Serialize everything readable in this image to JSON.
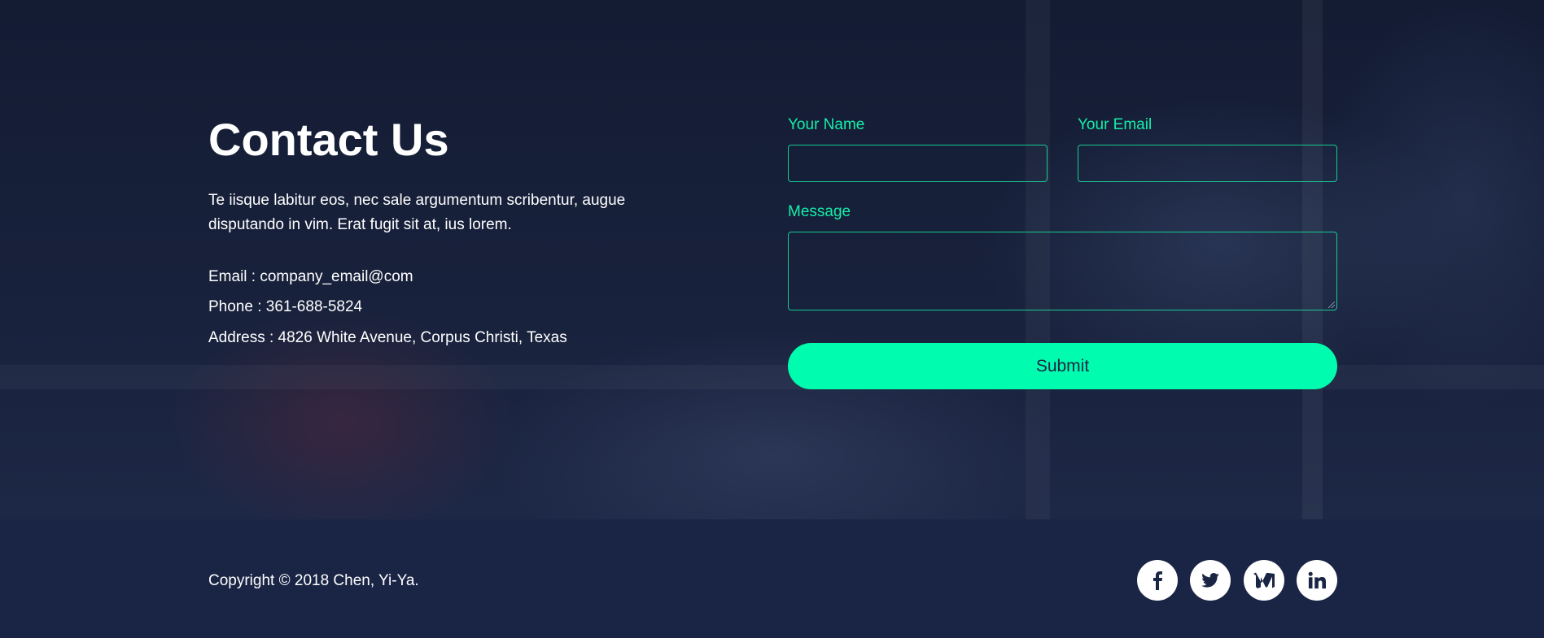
{
  "contact": {
    "title": "Contact Us",
    "description": "Te iisque labitur eos, nec sale argumentum scribentur, augue disputando in vim. Erat fugit sit at, ius lorem.",
    "email_line": "Email : company_email@com",
    "phone_line": "Phone : 361-688-5824",
    "address_line": "Address : 4826 White Avenue, Corpus Christi, Texas"
  },
  "form": {
    "name_label": "Your Name",
    "name_value": "",
    "email_label": "Your Email",
    "email_value": "",
    "message_label": "Message",
    "message_value": "",
    "submit_label": "Submit"
  },
  "footer": {
    "copyright": "Copyright © 2018 Chen, Yi-Ya.",
    "social": [
      {
        "icon": "facebook-icon"
      },
      {
        "icon": "twitter-icon"
      },
      {
        "icon": "medium-icon"
      },
      {
        "icon": "linkedin-icon"
      }
    ]
  },
  "colors": {
    "background": "#1a2545",
    "accent": "#00fcaf",
    "label": "#14eea8",
    "text": "#ffffff"
  }
}
